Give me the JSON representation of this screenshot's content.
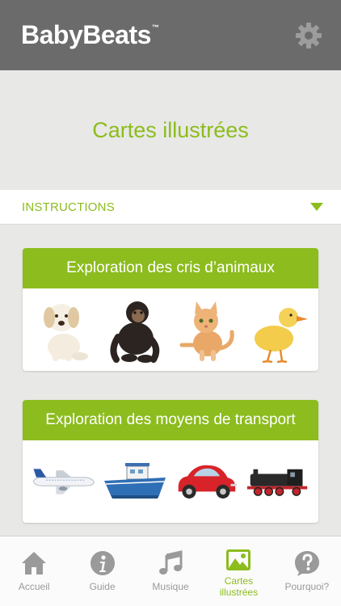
{
  "header": {
    "logo_text": "BabyBeats",
    "logo_tm": "™"
  },
  "page": {
    "title": "Cartes illustrées"
  },
  "instructions": {
    "label": "INSTRUCTIONS"
  },
  "cards": [
    {
      "title": "Exploration des cris d’animaux",
      "images": [
        "puppy",
        "chimpanzee",
        "kitten",
        "duckling"
      ]
    },
    {
      "title": "Exploration des moyens de transport",
      "images": [
        "airplane",
        "boat",
        "car",
        "train"
      ]
    }
  ],
  "tabs": [
    {
      "label": "Accueil",
      "icon": "home-icon"
    },
    {
      "label": "Guide",
      "icon": "info-icon"
    },
    {
      "label": "Musique",
      "icon": "music-note-icon"
    },
    {
      "label": "Cartes illustrées",
      "icon": "picture-icon",
      "active": true
    },
    {
      "label": "Pourquoi?",
      "icon": "question-bubble-icon"
    }
  ],
  "colors": {
    "accent": "#8cbc1e",
    "header_bg": "#6b6b6b",
    "tab_inactive": "#9a9a9a"
  }
}
